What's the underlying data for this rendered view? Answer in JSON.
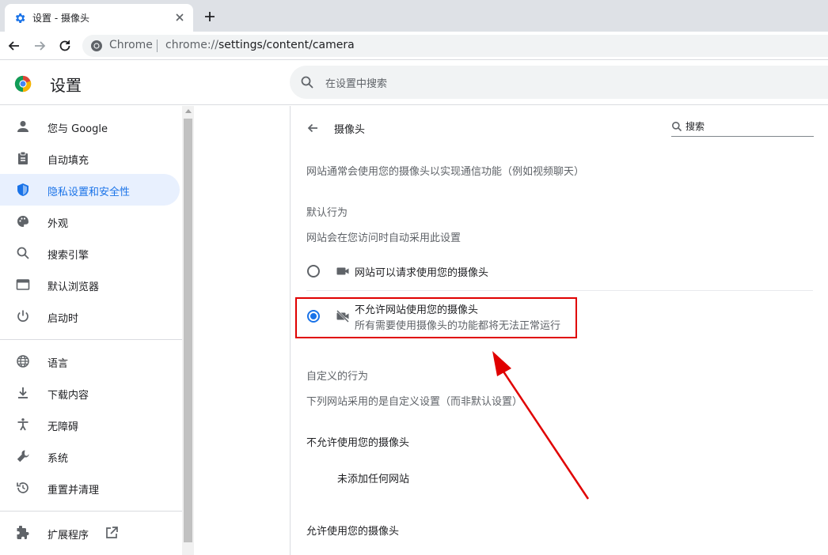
{
  "tab": {
    "title": "设置 - 摄像头",
    "favicon": "gear-icon",
    "close_icon": "close-icon"
  },
  "toolbar": {
    "chip": "Chrome",
    "url_scheme": "chrome://",
    "url_path": "settings/content/camera"
  },
  "header": {
    "title": "设置",
    "search_placeholder": "在设置中搜索"
  },
  "sidebar": {
    "items": [
      {
        "label": "您与 Google",
        "icon": "person-icon"
      },
      {
        "label": "自动填充",
        "icon": "clipboard-icon"
      },
      {
        "label": "隐私设置和安全性",
        "icon": "shield-icon",
        "active": true
      },
      {
        "label": "外观",
        "icon": "palette-icon"
      },
      {
        "label": "搜索引擎",
        "icon": "search-icon"
      },
      {
        "label": "默认浏览器",
        "icon": "browser-icon"
      },
      {
        "label": "启动时",
        "icon": "power-icon"
      },
      {
        "label": "语言",
        "icon": "globe-icon"
      },
      {
        "label": "下载内容",
        "icon": "download-icon"
      },
      {
        "label": "无障碍",
        "icon": "accessibility-icon"
      },
      {
        "label": "系统",
        "icon": "wrench-icon"
      },
      {
        "label": "重置并清理",
        "icon": "restore-icon"
      },
      {
        "label": "扩展程序",
        "icon": "puzzle-icon"
      }
    ]
  },
  "content": {
    "title": "摄像头",
    "search_placeholder": "搜索",
    "intro": "网站通常会使用您的摄像头以实现通信功能（例如视频聊天）",
    "default_heading": "默认行为",
    "default_desc": "网站会在您访问时自动采用此设置",
    "option_allow": "网站可以请求使用您的摄像头",
    "option_block": "不允许网站使用您的摄像头",
    "option_block_sub": "所有需要使用摄像头的功能都将无法正常运行",
    "selected_option": "block",
    "custom_heading": "自定义的行为",
    "custom_desc": "下列网站采用的是自定义设置（而非默认设置）",
    "blocked_heading": "不允许使用您的摄像头",
    "no_sites": "未添加任何网站",
    "allowed_heading": "允许使用您的摄像头"
  },
  "colors": {
    "accent": "#1a73e8",
    "annotation": "#e00000"
  }
}
